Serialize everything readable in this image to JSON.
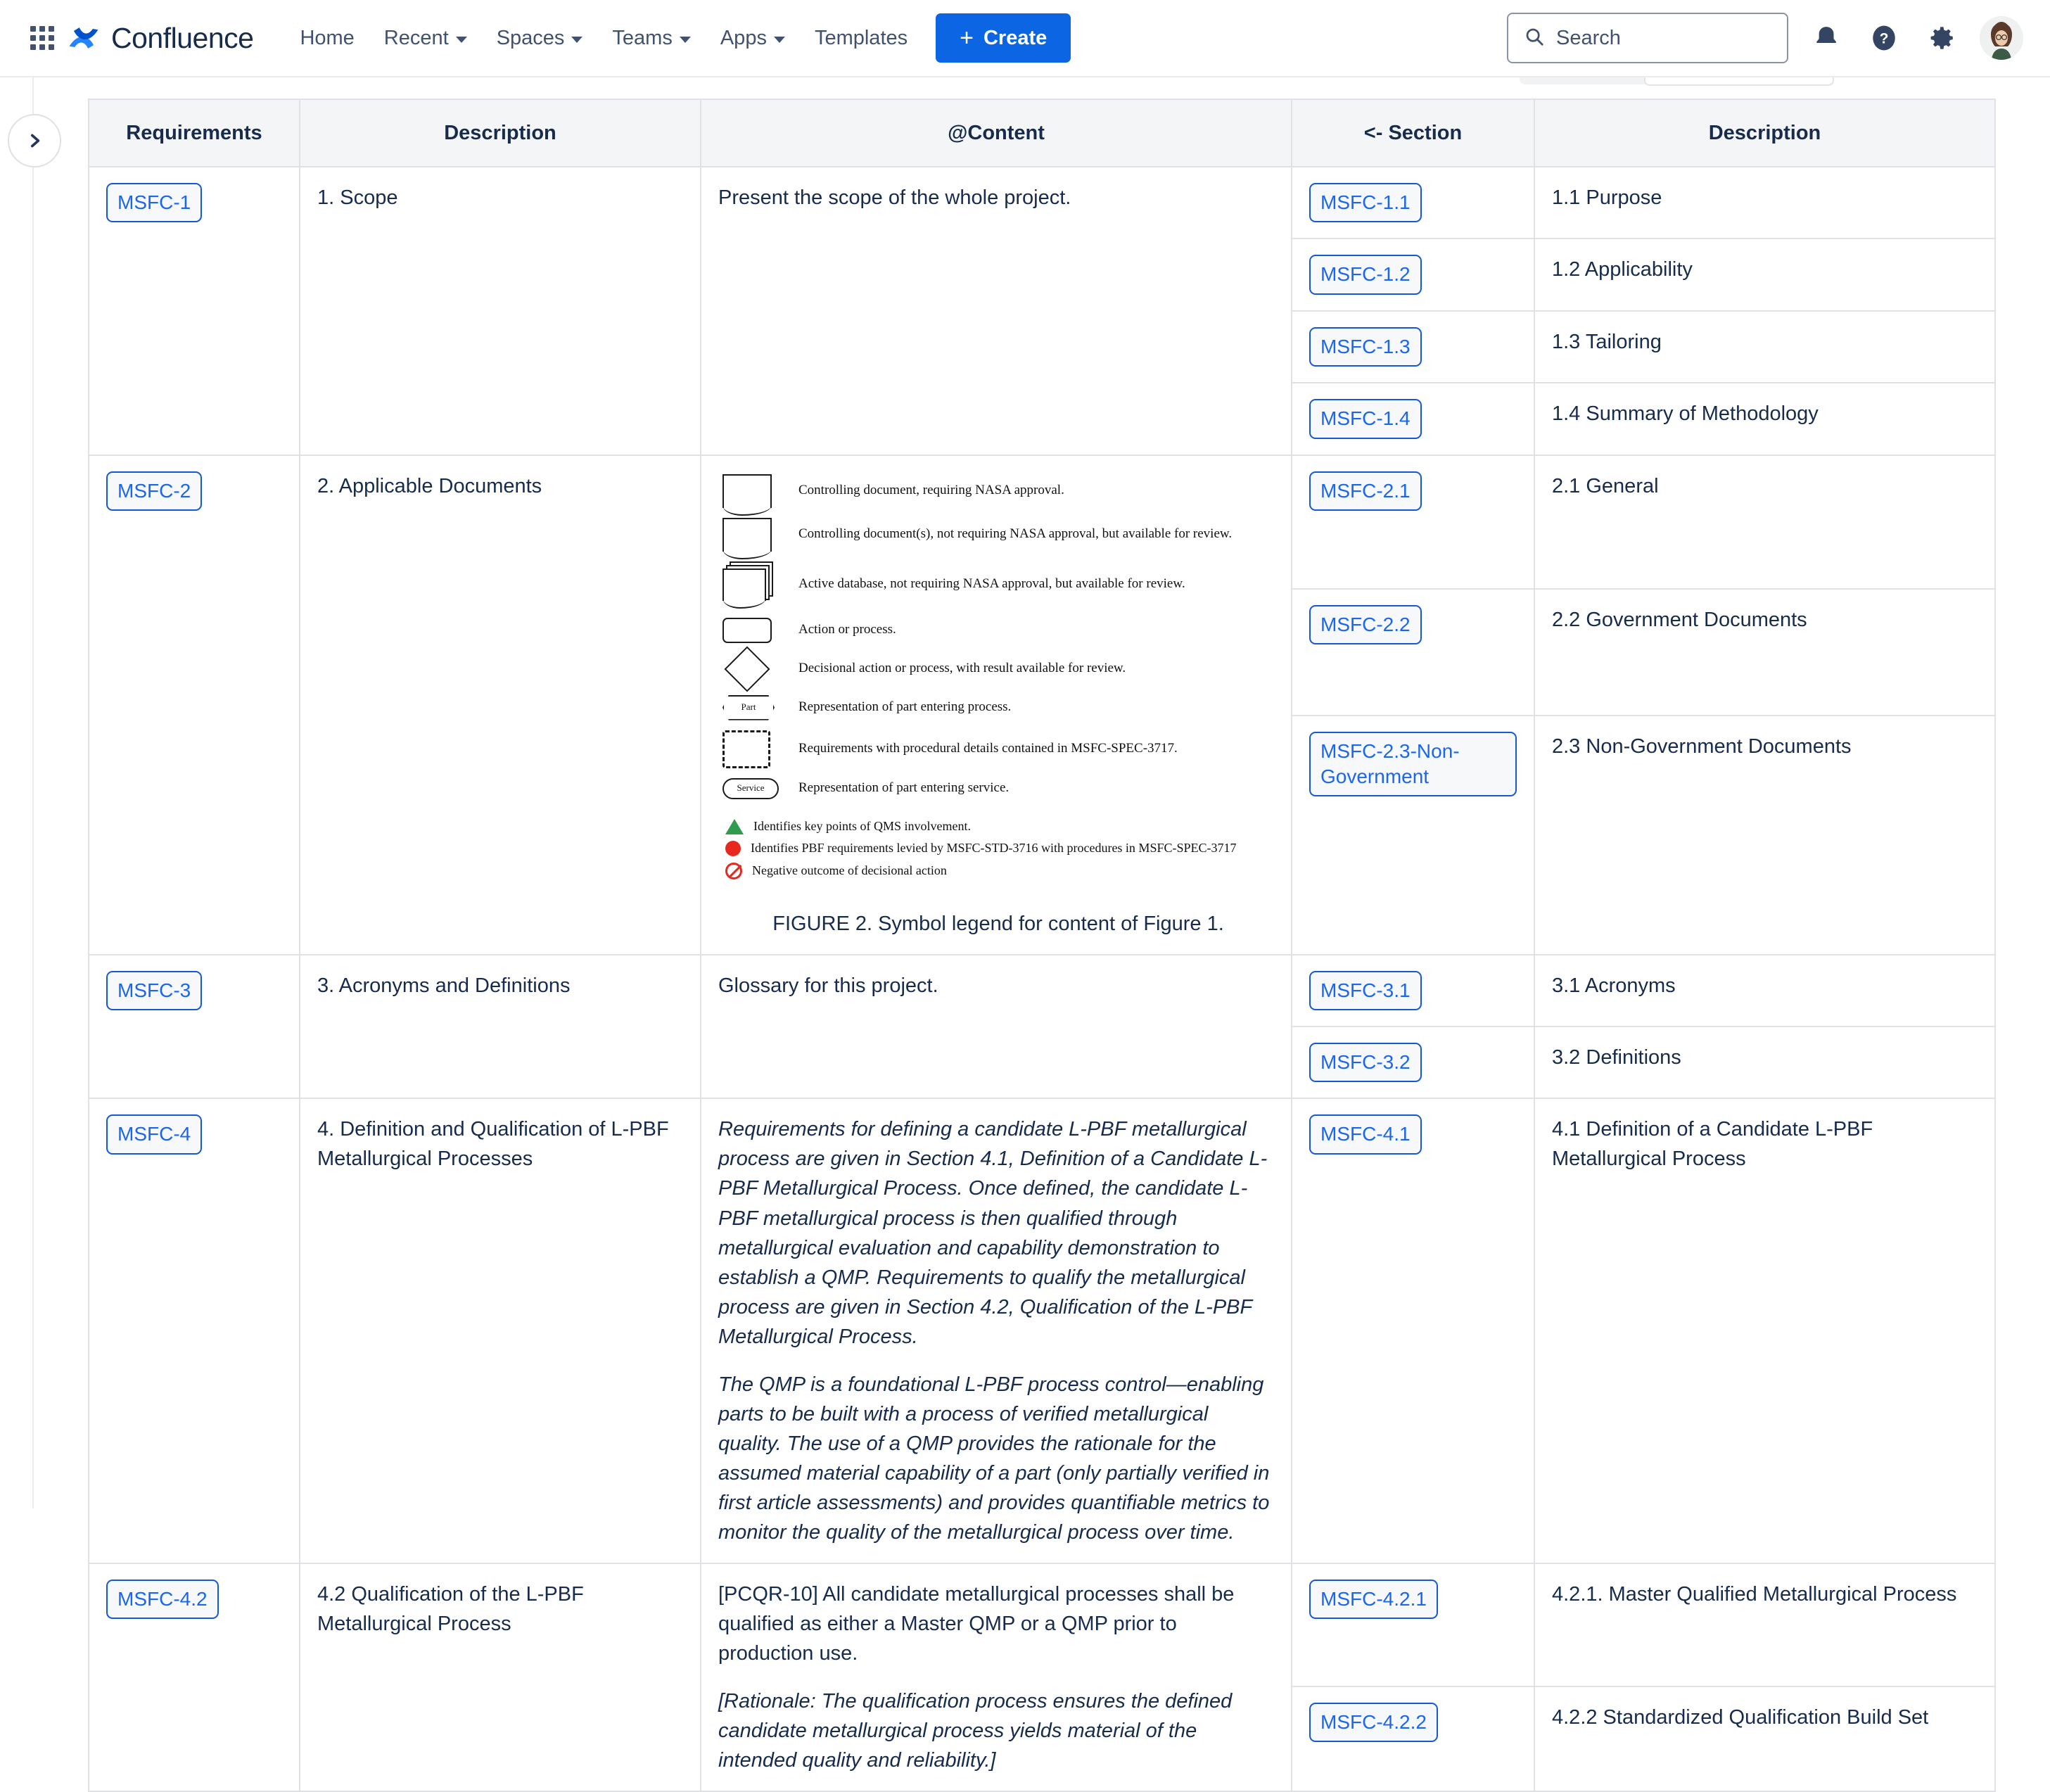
{
  "nav": {
    "brand": "Confluence",
    "links": [
      {
        "label": "Home",
        "has_caret": false
      },
      {
        "label": "Recent",
        "has_caret": true
      },
      {
        "label": "Spaces",
        "has_caret": true
      },
      {
        "label": "Teams",
        "has_caret": true
      },
      {
        "label": "Apps",
        "has_caret": true
      },
      {
        "label": "Templates",
        "has_caret": false
      }
    ],
    "create_label": "Create",
    "create_plus": "+",
    "search_placeholder": "Search",
    "icons": [
      "search-icon",
      "notifications-icon",
      "help-icon",
      "settings-icon",
      "avatar"
    ]
  },
  "colors": {
    "accent": "#0c66e4",
    "link": "#1a66f0",
    "link_border": "#1558d6",
    "text": "#172b4d",
    "header_bg": "#f4f5f7",
    "border": "#dfe1e6",
    "green": "#2e9b4f",
    "red": "#e8281e"
  },
  "table": {
    "headers": [
      "Requirements",
      "Description",
      "@Content",
      "<- Section",
      "Description"
    ],
    "rows": [
      {
        "req": "MSFC-1",
        "desc": "1. Scope",
        "content_paragraphs": [
          "Present the scope of the whole project."
        ],
        "sections": [
          {
            "tag": "MSFC-1.1",
            "desc": "1.1 Purpose"
          },
          {
            "tag": "MSFC-1.2",
            "desc": "1.2 Applicability"
          },
          {
            "tag": "MSFC-1.3",
            "desc": "1.3 Tailoring"
          },
          {
            "tag": "MSFC-1.4",
            "desc": "1.4 Summary of Methodology"
          }
        ]
      },
      {
        "req": "MSFC-2",
        "desc": "2. Applicable Documents",
        "figure_caption": "FIGURE 2. Symbol legend for content of Figure 1.",
        "legend": [
          {
            "symbol": "document-double",
            "text": "Controlling document, requiring NASA approval."
          },
          {
            "symbol": "document-single",
            "text": "Controlling document(s), not requiring NASA approval, but available for review."
          },
          {
            "symbol": "document-stack",
            "text": "Active database, not requiring NASA approval, but available for review."
          },
          {
            "symbol": "rounded-rect",
            "text": "Action or process."
          },
          {
            "symbol": "diamond",
            "text": "Decisional action or process, with result available for review."
          },
          {
            "symbol": "hexagon",
            "symbol_label": "Part",
            "text": "Representation of part entering process."
          },
          {
            "symbol": "dashed-rect",
            "text": "Requirements with procedural details contained in MSFC-SPEC-3717."
          },
          {
            "symbol": "pill",
            "symbol_label": "Service",
            "text": "Representation of part entering service."
          }
        ],
        "legend_minor": [
          {
            "symbol": "green-triangle",
            "text": "Identifies key points of QMS involvement."
          },
          {
            "symbol": "red-circle",
            "text": "Identifies PBF requirements levied by MSFC-STD-3716 with procedures in MSFC-SPEC-3717"
          },
          {
            "symbol": "red-no-entry",
            "text": "Negative outcome of decisional action"
          }
        ],
        "sections": [
          {
            "tag": "MSFC-2.1",
            "desc": "2.1 General"
          },
          {
            "tag": "MSFC-2.2",
            "desc": "2.2 Government Documents"
          },
          {
            "tag": "MSFC-2.3-Non-Government",
            "desc": "2.3 Non-Government Documents"
          }
        ]
      },
      {
        "req": "MSFC-3",
        "desc": "3. Acronyms and Definitions",
        "content_paragraphs": [
          "Glossary for this project."
        ],
        "sections": [
          {
            "tag": "MSFC-3.1",
            "desc": "3.1 Acronyms"
          },
          {
            "tag": "MSFC-3.2",
            "desc": "3.2 Definitions"
          }
        ]
      },
      {
        "req": "MSFC-4",
        "desc": "4. Definition and Qualification of L-PBF Metallurgical Processes",
        "content_paragraphs": [
          "Requirements for defining a candidate L-PBF metallurgical process are given in Section 4.1, Definition of a Candidate L-PBF Metallurgical Process. Once defined, the candidate L-PBF metallurgical process is then qualified through metallurgical evaluation and capability demonstration to establish a QMP. Requirements to qualify the metallurgical process are given in Section 4.2, Qualification of the L-PBF Metallurgical Process.",
          "The QMP is a foundational L-PBF process control—enabling parts to be built with a process of verified metallurgical quality. The use of a QMP provides the rationale for the assumed material capability of a part (only partially verified in first article assessments) and provides quantifiable metrics to monitor the quality of the metallurgical process over time."
        ],
        "content_italic": true,
        "sections": [
          {
            "tag": "MSFC-4.1",
            "desc": "4.1 Definition of a Candidate L-PBF Metallurgical Process"
          }
        ]
      },
      {
        "req": "MSFC-4.2",
        "desc": "4.2 Qualification of the L-PBF Metallurgical Process",
        "content_paragraphs": [
          "[PCQR-10] All candidate metallurgical processes shall be qualified as either a Master QMP or a QMP prior to production use."
        ],
        "content_italic_paragraphs": [
          "[Rationale: The qualification process ensures the defined candidate metallurgical process yields material of the intended quality and reliability.]"
        ],
        "sections": [
          {
            "tag": "MSFC-4.2.1",
            "desc": "4.2.1. Master Qualified Metallurgical Process"
          },
          {
            "tag": "MSFC-4.2.2",
            "desc": "4.2.2 Standardized Qualification Build Set"
          }
        ]
      }
    ]
  }
}
